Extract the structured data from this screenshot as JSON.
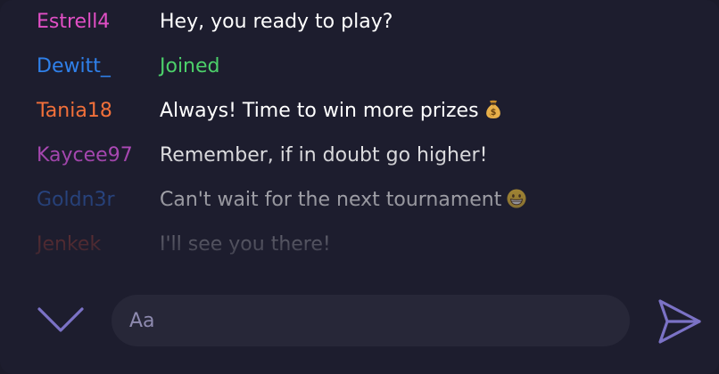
{
  "messages": [
    {
      "user": "Estrell4",
      "user_color": "#e14fc5",
      "text": "Hey, you ready to play?",
      "text_color": "#ffffff"
    },
    {
      "user": "Dewitt_",
      "user_color": "#2f80ea",
      "text": "Joined",
      "text_color": "#4cd06a"
    },
    {
      "user": "Tania18",
      "user_color": "#f2703a",
      "text": "Always! Time to win more prizes",
      "text_color": "#ffffff",
      "emoji": "💰"
    },
    {
      "user": "Kaycee97",
      "user_color": "#c04fc9",
      "text": "Remember, if in doubt go higher!",
      "text_color": "#ffffff"
    },
    {
      "user": "Goldn3r",
      "user_color": "#2f5fb8",
      "text": "Can't wait for the next tournament",
      "text_color": "#ffffff",
      "emoji": "😁"
    },
    {
      "user": "Jenkek",
      "user_color": "#f0553c",
      "text": "I'll see you there!",
      "text_color": "#ffffff"
    }
  ],
  "composer": {
    "placeholder": "Aa",
    "value": ""
  },
  "icons": {
    "collapse": "chevron-down-icon",
    "send": "send-icon"
  },
  "colors": {
    "panel_bg": "#1d1d2e",
    "input_bg": "#272738",
    "icon_accent": "#7b72c6"
  }
}
